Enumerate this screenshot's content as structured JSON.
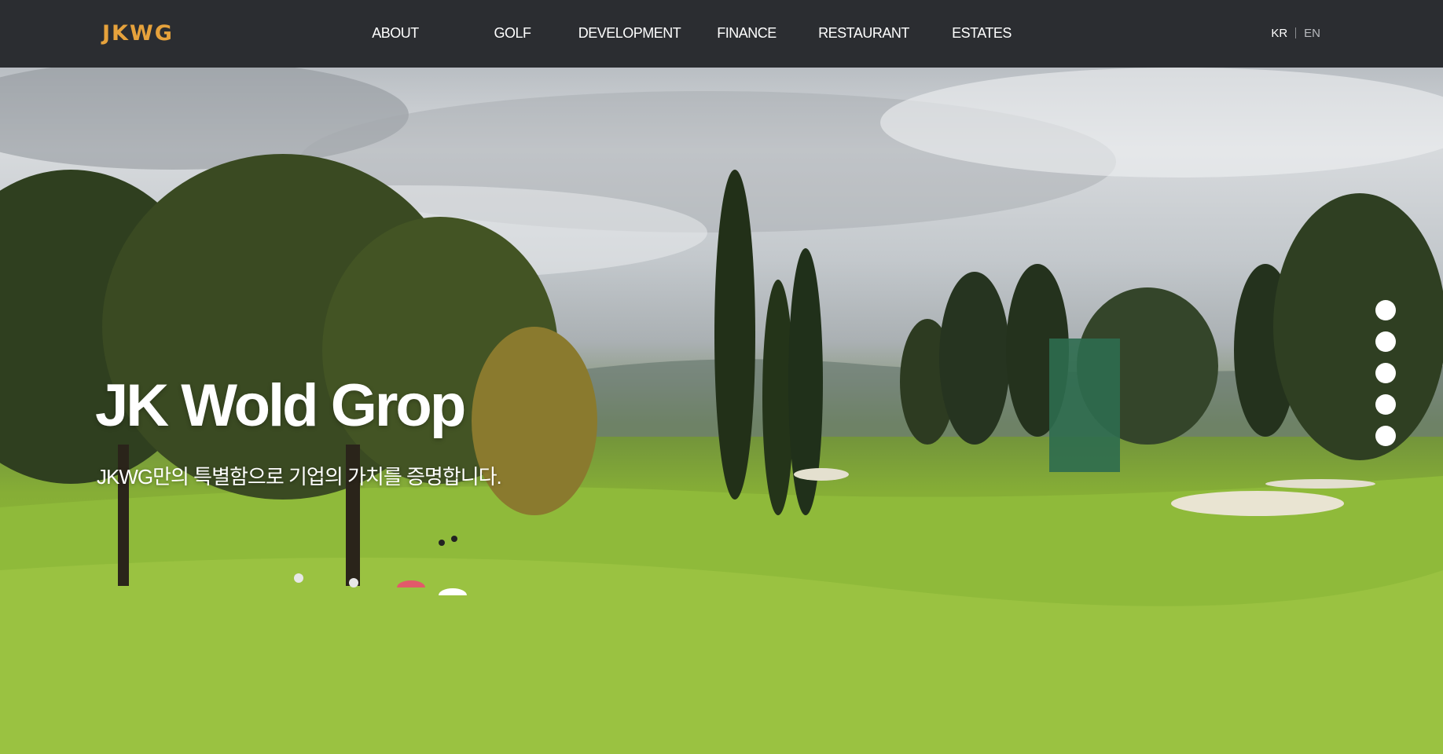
{
  "header": {
    "logo": "JKWG",
    "nav": [
      {
        "label": "ABOUT"
      },
      {
        "label": "GOLF"
      },
      {
        "label": "DEVELOPMENT"
      },
      {
        "label": "FINANCE"
      },
      {
        "label": "RESTAURANT"
      },
      {
        "label": "ESTATES"
      }
    ],
    "lang": {
      "kr": "KR",
      "en": "EN",
      "selected": "KR"
    }
  },
  "hero": {
    "title": "JK Wold Grop",
    "subtitle": "JKWG만의 특별함으로 기업의 가치를 증명합니다.",
    "background": "golf-course-photo",
    "slides": 5
  },
  "colors": {
    "header_bg": "#2b2d31",
    "logo": "#e6a23c",
    "nav_text": "#ffffff",
    "lang_inactive": "#b9bbbf"
  }
}
